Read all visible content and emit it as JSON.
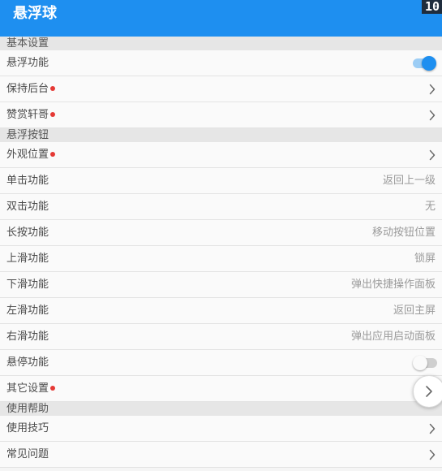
{
  "appbar": {
    "title": "悬浮球",
    "badge": "10",
    "color": "#1e8ff0"
  },
  "sections": [
    {
      "title": "基本设置",
      "rows": [
        {
          "label": "悬浮功能",
          "control": "toggle",
          "toggle_on": true
        },
        {
          "label": "保持后台",
          "control": "chevron",
          "dot": true
        },
        {
          "label": "赞赏轩哥",
          "control": "chevron",
          "dot": true
        }
      ]
    },
    {
      "title": "悬浮按钮",
      "rows": [
        {
          "label": "外观位置",
          "control": "chevron",
          "dot": true
        },
        {
          "label": "单击功能",
          "control": "value",
          "value": "返回上一级"
        },
        {
          "label": "双击功能",
          "control": "value",
          "value": "无"
        },
        {
          "label": "长按功能",
          "control": "value",
          "value": "移动按钮位置"
        },
        {
          "label": "上滑功能",
          "control": "value",
          "value": "锁屏"
        },
        {
          "label": "下滑功能",
          "control": "value",
          "value": "弹出快捷操作面板"
        },
        {
          "label": "左滑功能",
          "control": "value",
          "value": "返回主屏"
        },
        {
          "label": "右滑功能",
          "control": "value",
          "value": "弹出应用启动面板"
        },
        {
          "label": "悬停功能",
          "control": "toggle",
          "toggle_on": false
        },
        {
          "label": "其它设置",
          "control": "chevron",
          "dot": true
        }
      ]
    },
    {
      "title": "使用帮助",
      "rows": [
        {
          "label": "使用技巧",
          "control": "chevron"
        },
        {
          "label": "常见问题",
          "control": "chevron"
        }
      ]
    }
  ],
  "floating_button": {
    "icon": "chevron-right-icon"
  },
  "colors": {
    "accent": "#1e8ff0",
    "dot": "#e53935"
  }
}
